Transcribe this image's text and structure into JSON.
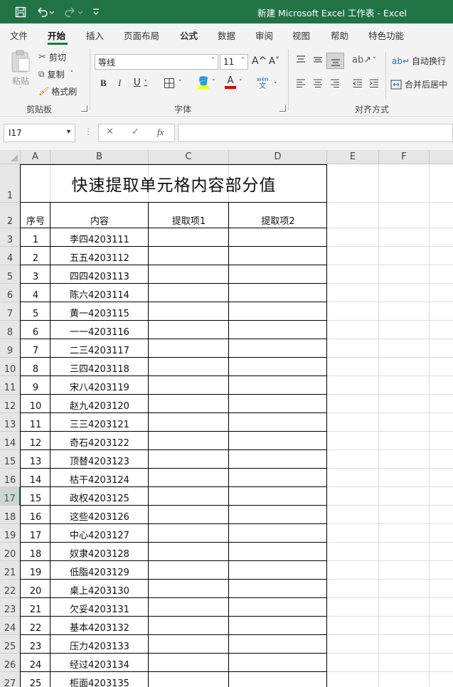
{
  "window": {
    "title": "新建 Microsoft Excel 工作表  -  Excel",
    "qat": [
      {
        "icon": "save-icon",
        "glyph": "💾"
      },
      {
        "icon": "undo-icon",
        "glyph": "↶"
      },
      {
        "icon": "redo-icon",
        "glyph": "↷"
      },
      {
        "icon": "customize-qat-icon",
        "glyph": "⩡"
      }
    ]
  },
  "tabs": [
    "文件",
    "开始",
    "插入",
    "页面布局",
    "公式",
    "数据",
    "审阅",
    "视图",
    "帮助",
    "特色功能"
  ],
  "active_tab": "开始",
  "ribbon": {
    "clipboard": {
      "group_label": "剪贴板",
      "paste_label": "粘贴",
      "cut_label": "剪切",
      "copy_label": "复制",
      "format_painter_label": "格式刷"
    },
    "font": {
      "group_label": "字体",
      "font_name": "等线",
      "font_size": "11",
      "grow_label": "A^",
      "shrink_label": "A˅",
      "bold": "B",
      "italic": "I",
      "underline": "U",
      "phonetic_label": "wén"
    },
    "alignment": {
      "group_label": "对齐方式",
      "wrap_label": "自动换行",
      "merge_label": "合并后居中"
    }
  },
  "formula_bar": {
    "name_box": "I17",
    "cancel_glyph": "✕",
    "enter_glyph": "✓",
    "fx_glyph": "fx",
    "formula": ""
  },
  "colors": {
    "accent": "#217346",
    "ribbon_bg": "#f3f3f3",
    "header_bg": "#e6e6e6"
  },
  "grid": {
    "columns": [
      "A",
      "B",
      "C",
      "D",
      "E",
      "F"
    ],
    "row_numbers": [
      "1",
      "2",
      "3",
      "4",
      "5",
      "6",
      "7",
      "8",
      "9",
      "10",
      "11",
      "12",
      "13",
      "14",
      "15",
      "16",
      "17",
      "18",
      "19",
      "20",
      "21",
      "22",
      "23",
      "24",
      "25",
      "26",
      "27"
    ],
    "selected_row": "17",
    "sheet_title": "快速提取单元格内容部分值",
    "table_headers": [
      "序号",
      "内容",
      "提取项1",
      "提取项2"
    ],
    "table_rows": [
      [
        "1",
        "李四4203111"
      ],
      [
        "2",
        "五五4203112"
      ],
      [
        "3",
        "四四4203113"
      ],
      [
        "4",
        "陈六4203114"
      ],
      [
        "5",
        "黄一4203115"
      ],
      [
        "6",
        "一一4203116"
      ],
      [
        "7",
        "二三4203117"
      ],
      [
        "8",
        "三四4203118"
      ],
      [
        "9",
        "宋八4203119"
      ],
      [
        "10",
        "赵九4203120"
      ],
      [
        "11",
        "三三4203121"
      ],
      [
        "12",
        "奇石4203122"
      ],
      [
        "13",
        "顶替4203123"
      ],
      [
        "14",
        "枯干4203124"
      ],
      [
        "15",
        "政权4203125"
      ],
      [
        "16",
        "这些4203126"
      ],
      [
        "17",
        "中心4203127"
      ],
      [
        "18",
        "奴隶4203128"
      ],
      [
        "19",
        "低脂4203129"
      ],
      [
        "20",
        "桌上4203130"
      ],
      [
        "21",
        "欠妥4203131"
      ],
      [
        "22",
        "基本4203132"
      ],
      [
        "23",
        "压力4203133"
      ],
      [
        "24",
        "经过4203134"
      ],
      [
        "25",
        "柜面4203135"
      ]
    ]
  }
}
